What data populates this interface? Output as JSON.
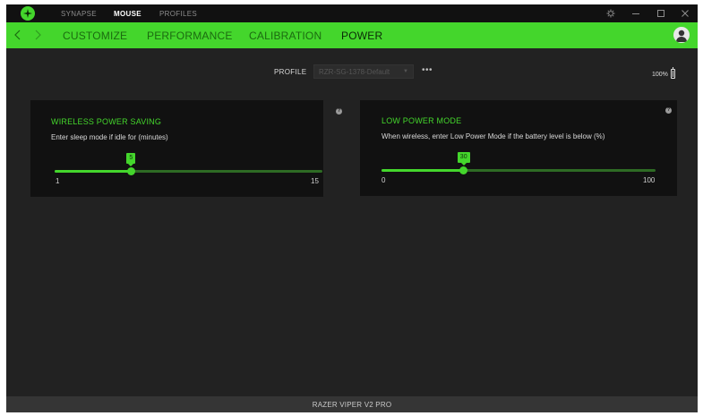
{
  "app": {
    "top_tabs": [
      {
        "label": "SYNAPSE",
        "active": false
      },
      {
        "label": "MOUSE",
        "active": true
      },
      {
        "label": "PROFILES",
        "active": false
      }
    ],
    "accent_color": "#44d62c"
  },
  "nav": {
    "tabs": [
      {
        "label": "CUSTOMIZE",
        "active": false
      },
      {
        "label": "PERFORMANCE",
        "active": false
      },
      {
        "label": "CALIBRATION",
        "active": false
      },
      {
        "label": "POWER",
        "active": true
      }
    ]
  },
  "profile": {
    "label": "PROFILE",
    "selected": "RZR-SG-1378-Default",
    "more": "•••"
  },
  "battery": {
    "text": "100%",
    "level": 1.0
  },
  "wireless_power_saving": {
    "title": "WIRELESS POWER SAVING",
    "description": "Enter sleep mode if idle for (minutes)",
    "value": "5",
    "min_label": "1",
    "max_label": "15",
    "fraction": 0.2857,
    "help": "?"
  },
  "low_power_mode": {
    "title": "LOW POWER MODE",
    "description": "When wireless, enter Low Power Mode if the battery level is below (%)",
    "value": "30",
    "min_label": "0",
    "max_label": "100",
    "fraction": 0.3,
    "help": "?"
  },
  "footer": {
    "device": "RAZER VIPER V2 PRO"
  }
}
